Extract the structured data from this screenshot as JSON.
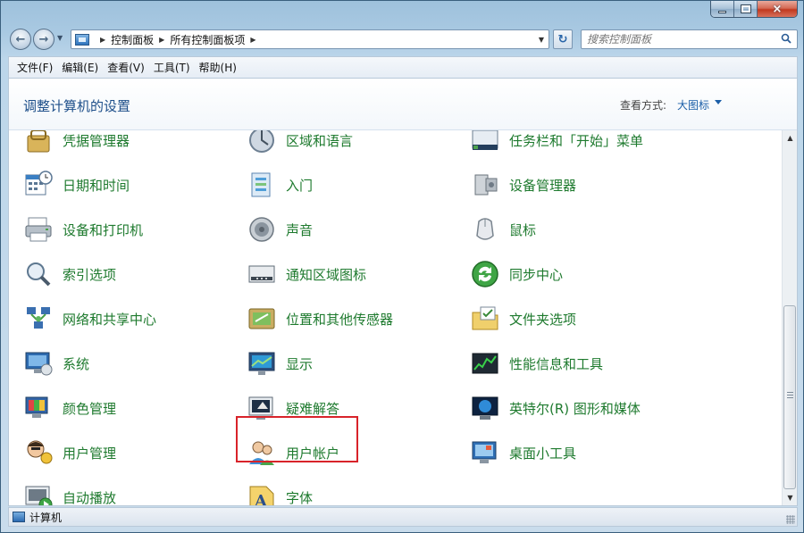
{
  "window": {
    "controls": {
      "minimize": "minimize",
      "maximize": "maximize",
      "close": "×"
    }
  },
  "nav": {
    "breadcrumb": [
      "控制面板",
      "所有控制面板项"
    ],
    "search_placeholder": "搜索控制面板"
  },
  "menu": [
    "文件(F)",
    "编辑(E)",
    "查看(V)",
    "工具(T)",
    "帮助(H)"
  ],
  "header": {
    "title": "调整计算机的设置",
    "view_label": "查看方式:",
    "view_value": "大图标"
  },
  "items": [
    {
      "label": "凭据管理器",
      "icon": "credential-icon"
    },
    {
      "label": "区域和语言",
      "icon": "region-icon"
    },
    {
      "label": "任务栏和「开始」菜单",
      "icon": "taskbar-icon"
    },
    {
      "label": "日期和时间",
      "icon": "calendar-clock-icon"
    },
    {
      "label": "入门",
      "icon": "getting-started-icon"
    },
    {
      "label": "设备管理器",
      "icon": "device-manager-icon"
    },
    {
      "label": "设备和打印机",
      "icon": "printer-icon"
    },
    {
      "label": "声音",
      "icon": "speaker-icon"
    },
    {
      "label": "鼠标",
      "icon": "mouse-icon"
    },
    {
      "label": "索引选项",
      "icon": "indexing-icon"
    },
    {
      "label": "通知区域图标",
      "icon": "notification-area-icon"
    },
    {
      "label": "同步中心",
      "icon": "sync-center-icon"
    },
    {
      "label": "网络和共享中心",
      "icon": "network-icon"
    },
    {
      "label": "位置和其他传感器",
      "icon": "location-sensor-icon"
    },
    {
      "label": "文件夹选项",
      "icon": "folder-options-icon"
    },
    {
      "label": "系统",
      "icon": "system-icon"
    },
    {
      "label": "显示",
      "icon": "display-icon"
    },
    {
      "label": "性能信息和工具",
      "icon": "performance-icon"
    },
    {
      "label": "颜色管理",
      "icon": "color-management-icon"
    },
    {
      "label": "疑难解答",
      "icon": "troubleshooting-icon"
    },
    {
      "label": "英特尔(R) 图形和媒体",
      "icon": "intel-graphics-icon"
    },
    {
      "label": "用户管理",
      "icon": "user-management-icon"
    },
    {
      "label": "用户帐户",
      "icon": "user-accounts-icon"
    },
    {
      "label": "桌面小工具",
      "icon": "gadgets-icon"
    },
    {
      "label": "自动播放",
      "icon": "autoplay-icon"
    },
    {
      "label": "字体",
      "icon": "fonts-icon"
    }
  ],
  "status": {
    "text": "计算机"
  },
  "colors": {
    "item_label": "#1e7a2e",
    "title": "#1e4f8a",
    "highlight": "#d8232a"
  }
}
